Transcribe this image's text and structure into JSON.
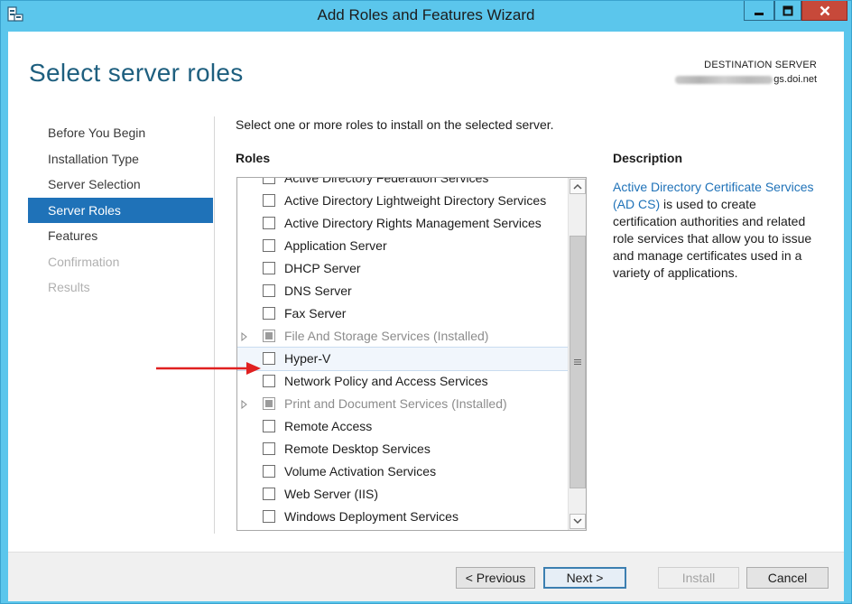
{
  "window": {
    "title": "Add Roles and Features Wizard"
  },
  "page": {
    "title": "Select server roles",
    "destination_label": "DESTINATION SERVER",
    "destination_host_visible": "gs.doi.net"
  },
  "nav": {
    "items": [
      {
        "label": "Before You Begin",
        "state": "normal"
      },
      {
        "label": "Installation Type",
        "state": "normal"
      },
      {
        "label": "Server Selection",
        "state": "normal"
      },
      {
        "label": "Server Roles",
        "state": "active"
      },
      {
        "label": "Features",
        "state": "normal"
      },
      {
        "label": "Confirmation",
        "state": "disabled"
      },
      {
        "label": "Results",
        "state": "disabled"
      }
    ]
  },
  "main": {
    "instruction": "Select one or more roles to install on the selected server.",
    "roles_heading": "Roles",
    "roles": [
      {
        "label": "Active Directory Federation Services",
        "checked": false,
        "installed": false,
        "expandable": false,
        "selected": false
      },
      {
        "label": "Active Directory Lightweight Directory Services",
        "checked": false,
        "installed": false,
        "expandable": false,
        "selected": false
      },
      {
        "label": "Active Directory Rights Management Services",
        "checked": false,
        "installed": false,
        "expandable": false,
        "selected": false
      },
      {
        "label": "Application Server",
        "checked": false,
        "installed": false,
        "expandable": false,
        "selected": false
      },
      {
        "label": "DHCP Server",
        "checked": false,
        "installed": false,
        "expandable": false,
        "selected": false
      },
      {
        "label": "DNS Server",
        "checked": false,
        "installed": false,
        "expandable": false,
        "selected": false
      },
      {
        "label": "Fax Server",
        "checked": false,
        "installed": false,
        "expandable": false,
        "selected": false
      },
      {
        "label": "File And Storage Services (Installed)",
        "checked": false,
        "installed": true,
        "expandable": true,
        "selected": false
      },
      {
        "label": "Hyper-V",
        "checked": false,
        "installed": false,
        "expandable": false,
        "selected": true
      },
      {
        "label": "Network Policy and Access Services",
        "checked": false,
        "installed": false,
        "expandable": false,
        "selected": false
      },
      {
        "label": "Print and Document Services (Installed)",
        "checked": false,
        "installed": true,
        "expandable": true,
        "selected": false
      },
      {
        "label": "Remote Access",
        "checked": false,
        "installed": false,
        "expandable": false,
        "selected": false
      },
      {
        "label": "Remote Desktop Services",
        "checked": false,
        "installed": false,
        "expandable": false,
        "selected": false
      },
      {
        "label": "Volume Activation Services",
        "checked": false,
        "installed": false,
        "expandable": false,
        "selected": false
      },
      {
        "label": "Web Server (IIS)",
        "checked": false,
        "installed": false,
        "expandable": false,
        "selected": false
      },
      {
        "label": "Windows Deployment Services",
        "checked": false,
        "installed": false,
        "expandable": false,
        "selected": false
      }
    ]
  },
  "description": {
    "heading": "Description",
    "link_text": "Active Directory Certificate Services (AD CS)",
    "body_text": " is used to create certification authorities and related role services that allow you to issue and manage certificates used in a variety of applications."
  },
  "footer": {
    "previous_label": "< Previous",
    "next_label": "Next >",
    "install_label": "Install",
    "cancel_label": "Cancel"
  },
  "colors": {
    "title_bar": "#5bc6ec",
    "accent": "#1f72b8",
    "page_title": "#1e5f7f",
    "close_button": "#c7493a",
    "annotation_arrow": "#e02020"
  }
}
